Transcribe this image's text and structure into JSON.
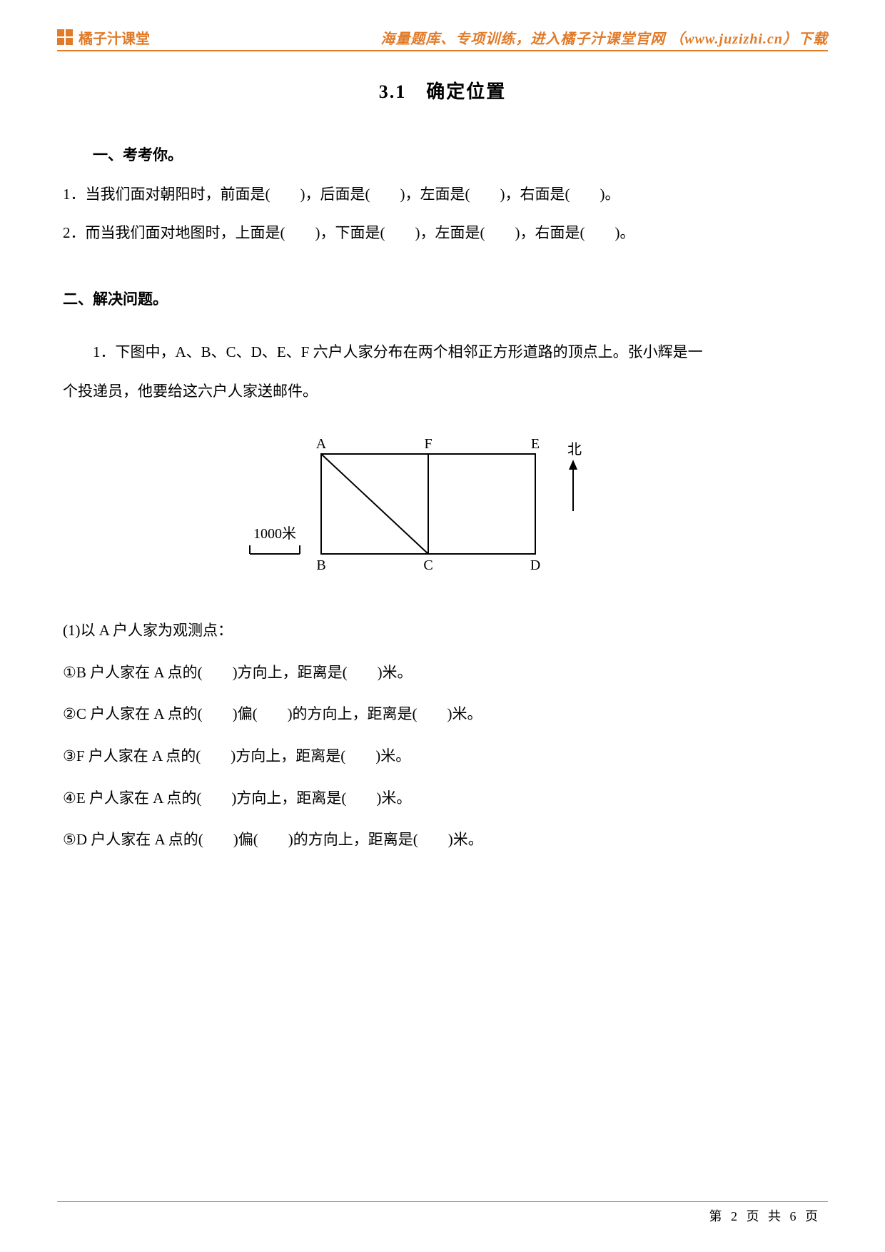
{
  "header": {
    "brand": "橘子汁课堂",
    "right": "海量题库、专项训练，进入橘子汁课堂官网 （www.juzizhi.cn）下载"
  },
  "title": "3.1　确定位置",
  "section1": {
    "heading": "一、考考你。",
    "q1": "1．当我们面对朝阳时，前面是(　　)，后面是(　　)，左面是(　　)，右面是(　　)。",
    "q2": "2．而当我们面对地图时，上面是(　　)，下面是(　　)，左面是(　　)，右面是(　　)。"
  },
  "section2": {
    "heading": "二、解决问题。",
    "p1_line1": "1．下图中，A、B、C、D、E、F 六户人家分布在两个相邻正方形道路的顶点上。张小辉是一",
    "p1_line2": "个投递员，他要给这六户人家送邮件。",
    "diagram": {
      "A": "A",
      "B": "B",
      "C": "C",
      "D": "D",
      "E": "E",
      "F": "F",
      "north": "北",
      "scale": "1000米"
    },
    "sub_intro": "(1)以 A 户人家为观测点：",
    "s1": "①B 户人家在 A 点的(　　)方向上，距离是(　　)米。",
    "s2": "②C 户人家在 A 点的(　　)偏(　　)的方向上，距离是(　　)米。",
    "s3": "③F 户人家在 A 点的(　　)方向上，距离是(　　)米。",
    "s4": "④E 户人家在 A 点的(　　)方向上，距离是(　　)米。",
    "s5": "⑤D 户人家在 A 点的(　　)偏(　　)的方向上，距离是(　　)米。"
  },
  "footer": "第 2 页 共 6 页"
}
